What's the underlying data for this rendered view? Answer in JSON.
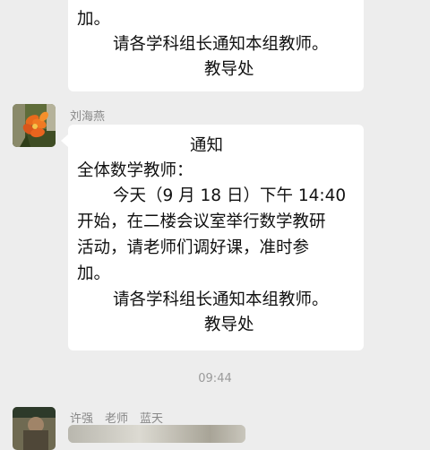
{
  "message_top": {
    "line_partial": "",
    "line_end": "加。",
    "line_notify": "请各学科组长通知本组教师。",
    "line_sign": "教导处"
  },
  "message_main": {
    "sender": "刘海燕",
    "title": "通知",
    "greeting": "全体数学教师：",
    "body_lines": [
      "今天（9 月 18 日）下午 14:40",
      "开始，在二楼会议室举行数学教研",
      "活动，请老师们调好课，准时参",
      "加。"
    ],
    "notify": "请各学科组长通知本组教师。",
    "sign": "教导处"
  },
  "timestamp": "09:44",
  "message_bottom": {
    "sender_names": "许强　老师　蓝天"
  },
  "colors": {
    "background": "#ededed",
    "bubble": "#ffffff",
    "sender_text": "#888888",
    "timestamp_text": "#9a9a9a"
  }
}
